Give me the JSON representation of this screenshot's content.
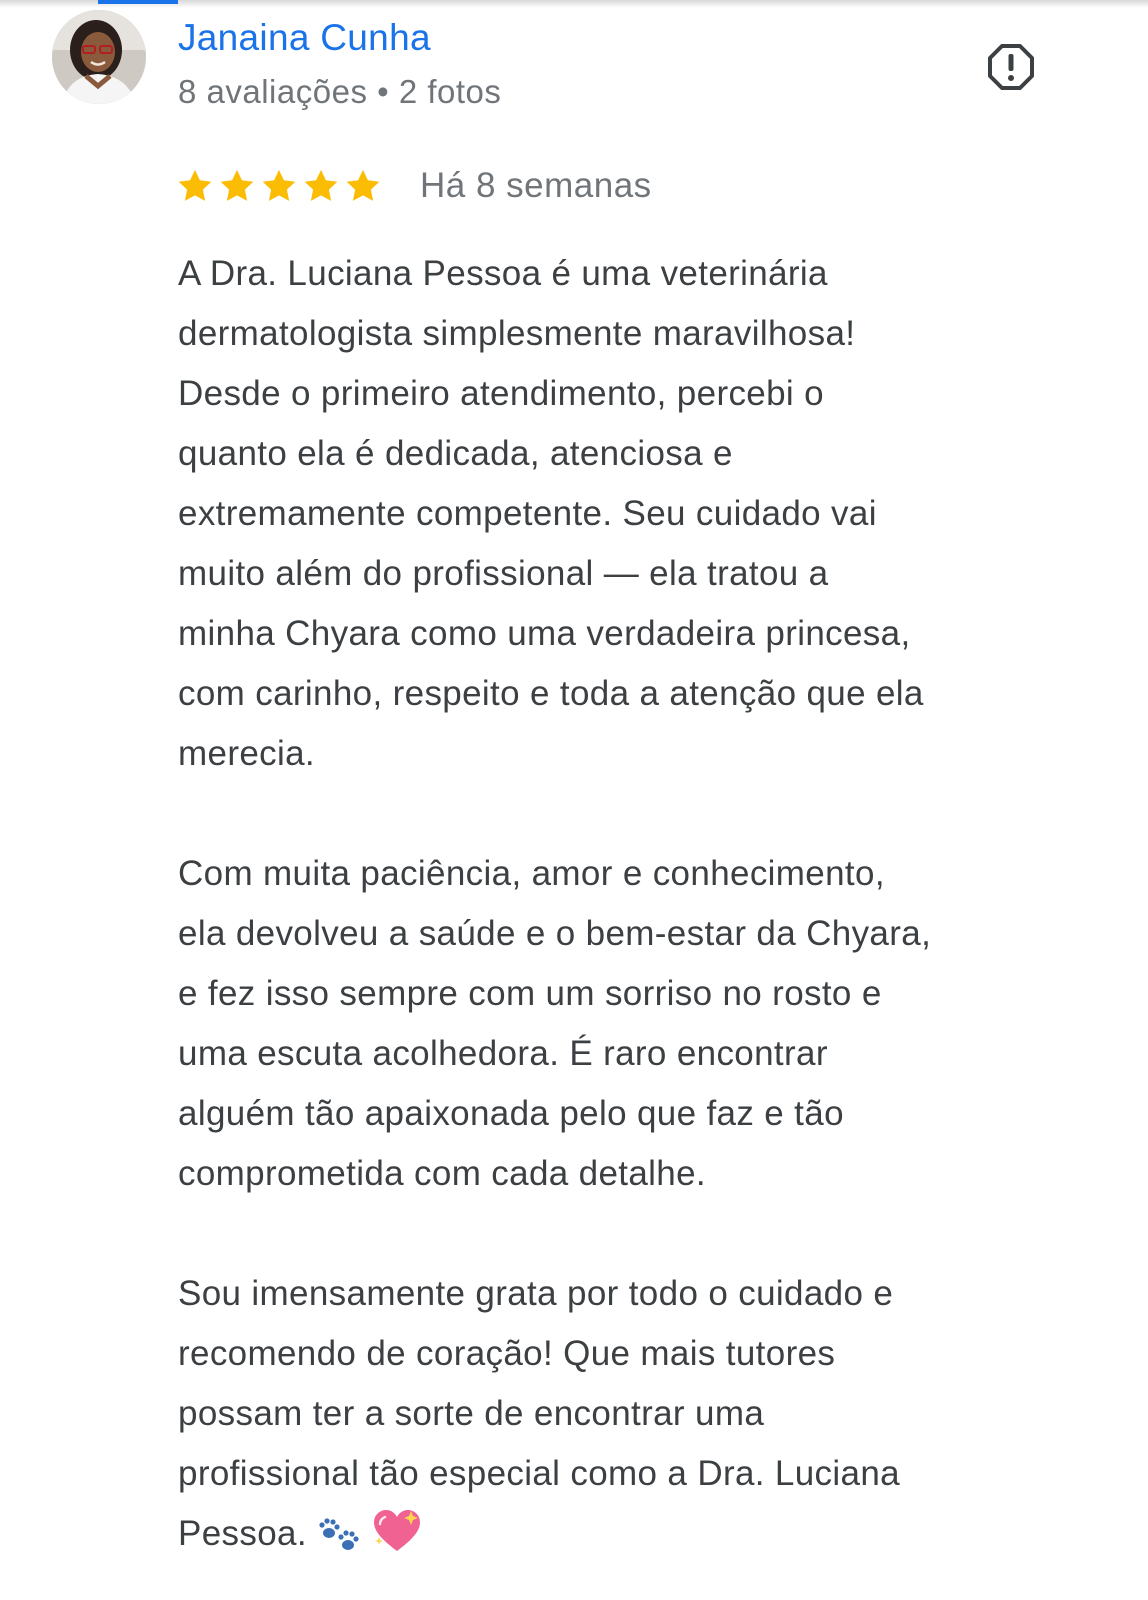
{
  "reviewer": {
    "name": "Janaina Cunha",
    "meta": "8 avaliações • 2 fotos",
    "avatar_icon": "profile-photo"
  },
  "report_icon": "report-flag-icon",
  "rating": {
    "stars": 5,
    "max_stars": 5,
    "star_color": "#fbbc04",
    "date": "Há 8 semanas"
  },
  "review": {
    "paragraphs": [
      {
        "lines": [
          "A Dra. Luciana Pessoa é uma veterinária",
          "dermatologista simplesmente maravilhosa!",
          "Desde o primeiro atendimento, percebi o",
          "quanto ela é dedicada, atenciosa e",
          "extremamente competente. Seu cuidado vai",
          "muito além do profissional — ela tratou a",
          "minha Chyara como uma verdadeira princesa,",
          "com carinho, respeito e toda a atenção que ela",
          "merecia."
        ]
      },
      {
        "lines": [
          "Com muita paciência, amor e conhecimento,",
          "ela devolveu a saúde e o bem-estar da Chyara,",
          "e fez isso sempre com um sorriso no rosto e",
          "uma escuta acolhedora. É raro encontrar",
          "alguém tão apaixonada pelo que faz e tão",
          "comprometida com cada detalhe."
        ]
      },
      {
        "lines": [
          "Sou imensamente grata por todo o cuidado e",
          "recomendo de coração! Que mais tutores",
          "possam ter a sorte de encontrar uma",
          "profissional tão especial como a Dra. Luciana",
          "Pessoa."
        ],
        "trailing_emoji": [
          "paw-prints-emoji",
          "sparkling-heart-emoji"
        ]
      }
    ]
  },
  "colors": {
    "name": "#1a73e8",
    "meta": "#70757a",
    "body_text": "#3c4043",
    "star": "#fbbc04"
  }
}
